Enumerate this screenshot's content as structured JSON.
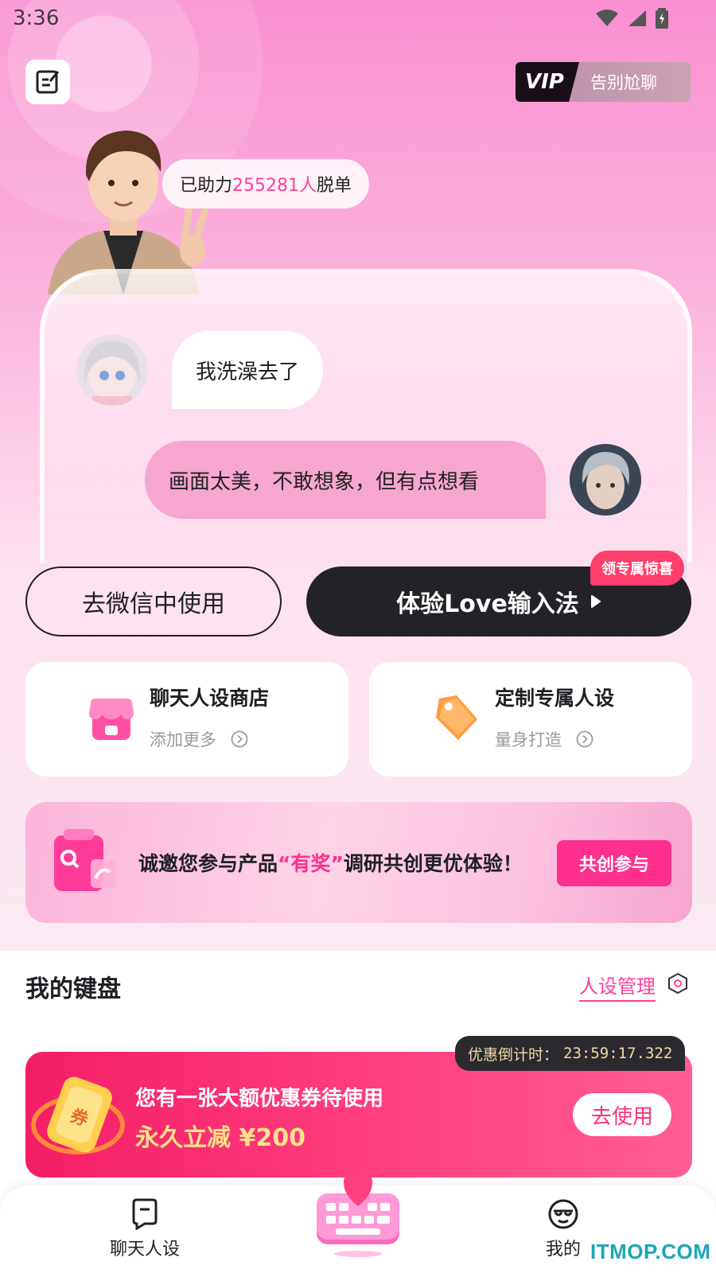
{
  "status_bar": {
    "time": "3:36"
  },
  "header": {
    "vip_tag": "VIP",
    "vip_text": "告别尬聊"
  },
  "hero": {
    "help_prefix": "已助力",
    "help_count": "255281人",
    "help_suffix": "脱单"
  },
  "chat_demo": {
    "incoming_message": "我洗澡去了",
    "outgoing_message": "画面太美，不敢想象，但有点想看"
  },
  "actions": {
    "wechat_button": "去微信中使用",
    "try_button": "体验Love输入法",
    "gift_badge": "领专属惊喜"
  },
  "features": [
    {
      "title": "聊天人设商店",
      "subtitle": "添加更多"
    },
    {
      "title": "定制专属人设",
      "subtitle": "量身打造"
    }
  ],
  "survey": {
    "text_prefix": "诚邀您参与产品",
    "text_highlight": "“有奖”",
    "text_suffix": "调研共创更优体验！",
    "button": "共创参与"
  },
  "keyboard_section": {
    "title": "我的键盘",
    "persona_link": "人设管理"
  },
  "coupon": {
    "countdown_label": "优惠倒计时：",
    "countdown_value": "23:59:17.322",
    "line1": "您有一张大额优惠券待使用",
    "line2": "永久立减 ¥200",
    "button": "去使用",
    "badge_glyph": "券"
  },
  "bottom_nav": {
    "items": [
      {
        "label": "聊天人设",
        "icon": "chat-persona-icon"
      },
      {
        "label": "",
        "icon": "keyboard-heart-icon"
      },
      {
        "label": "我的",
        "icon": "profile-icon"
      }
    ]
  },
  "watermark": "ITMOP.COM",
  "colors": {
    "accent_pink": "#ff3f9c",
    "dark_button": "#232227",
    "coupon_red": "#f31e66",
    "coupon_yellow": "#ffe28a"
  }
}
